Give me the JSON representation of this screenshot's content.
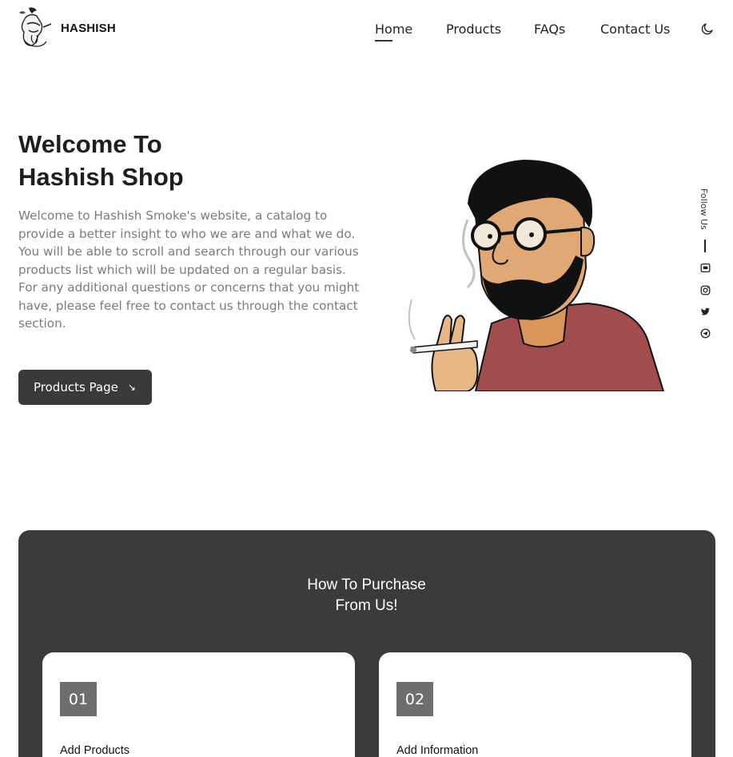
{
  "brand": {
    "name": "HASHISH",
    "logo_icon": "smoking-character-logo-icon"
  },
  "nav": {
    "items": [
      {
        "label": "Home",
        "active": true
      },
      {
        "label": "Products"
      },
      {
        "label": "FAQs"
      },
      {
        "label": "Contact Us"
      }
    ],
    "theme_toggle_icon": "moon-icon"
  },
  "hero": {
    "title": "Welcome To",
    "subtitle": "Hashish Shop",
    "description": "Welcome to Hashish Smoke's website, a catalog to provide a better insight to who we are and what we do. You will be able to scroll and search through our various products list which will be updated on a regular basis. For any additional questions or concerns that you might have, please feel free to contact us through the contact section.",
    "button_label": "Products Page",
    "button_icon": "arrow-down-right-icon",
    "illustration": "smoking-man-illustration"
  },
  "follow": {
    "label": "Follow Us",
    "icons": [
      "discord-icon",
      "instagram-icon",
      "twitter-icon",
      "telegram-icon"
    ]
  },
  "how_to": {
    "title_line1": "How To Purchase",
    "title_line2": "From Us!",
    "steps": [
      {
        "number": "01",
        "title": "Add Products"
      },
      {
        "number": "02",
        "title": "Add Information"
      }
    ]
  },
  "colors": {
    "dark": "#3b3b3b",
    "muted_text": "#7b7b7b",
    "step_badge": "#6e6e6e"
  }
}
